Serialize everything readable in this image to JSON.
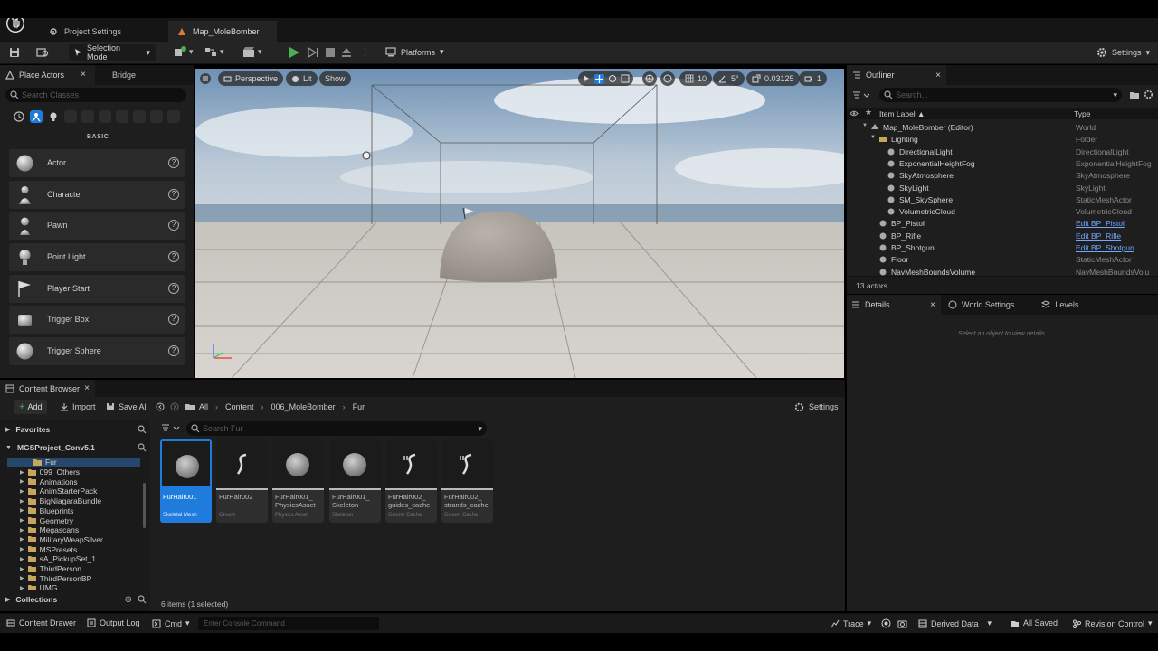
{
  "tabs": {
    "project_settings": "Project Settings",
    "map": "Map_MoleBomber"
  },
  "toolbar": {
    "selection_mode": "Selection Mode",
    "platforms": "Platforms",
    "settings": "Settings"
  },
  "place_actors": {
    "tab_label": "Place Actors",
    "bridge_label": "Bridge",
    "search_placeholder": "Search Classes",
    "category": "BASIC",
    "items": [
      {
        "label": "Actor",
        "icon": "sphere-icon"
      },
      {
        "label": "Character",
        "icon": "character-icon"
      },
      {
        "label": "Pawn",
        "icon": "pawn-icon"
      },
      {
        "label": "Point Light",
        "icon": "light-bulb-icon"
      },
      {
        "label": "Player Start",
        "icon": "player-start-icon"
      },
      {
        "label": "Trigger Box",
        "icon": "trigger-box-icon"
      },
      {
        "label": "Trigger Sphere",
        "icon": "trigger-sphere-icon"
      }
    ]
  },
  "viewport": {
    "perspective": "Perspective",
    "lit": "Lit",
    "show": "Show",
    "grid_size": "10",
    "rotation_snap": "5°",
    "scale_snap": "0.03125",
    "camera_speed": "1"
  },
  "outliner": {
    "title": "Outliner",
    "search_placeholder": "Search...",
    "col_label": "Item Label ▲",
    "col_type": "Type",
    "rows": [
      {
        "label": "Map_MoleBomber (Editor)",
        "type": "World",
        "link": false,
        "indent": 2
      },
      {
        "label": "Lighting",
        "type": "Folder",
        "link": false,
        "indent": 3
      },
      {
        "label": "DirectionalLight",
        "type": "DirectionalLight",
        "link": false,
        "indent": 4
      },
      {
        "label": "ExponentialHeightFog",
        "type": "ExponentialHeightFog",
        "link": false,
        "indent": 4
      },
      {
        "label": "SkyAtmosphere",
        "type": "SkyAtmosphere",
        "link": false,
        "indent": 4
      },
      {
        "label": "SkyLight",
        "type": "SkyLight",
        "link": false,
        "indent": 4
      },
      {
        "label": "SM_SkySphere",
        "type": "StaticMeshActor",
        "link": false,
        "indent": 4
      },
      {
        "label": "VolumetricCloud",
        "type": "VolumetricCloud",
        "link": false,
        "indent": 4
      },
      {
        "label": "BP_Pistol",
        "type": "Edit BP_Pistol",
        "link": true,
        "indent": 3
      },
      {
        "label": "BP_Rifle",
        "type": "Edit BP_Rifle",
        "link": true,
        "indent": 3
      },
      {
        "label": "BP_Shotgun",
        "type": "Edit BP_Shotgun",
        "link": true,
        "indent": 3
      },
      {
        "label": "Floor",
        "type": "StaticMeshActor",
        "link": false,
        "indent": 3
      },
      {
        "label": "NavMeshBoundsVolume",
        "type": "NavMeshBoundsVolu",
        "link": false,
        "indent": 3
      }
    ],
    "count": "13 actors"
  },
  "details": {
    "tab_details": "Details",
    "tab_world_settings": "World Settings",
    "tab_levels": "Levels",
    "empty_message": "Select an object to view details."
  },
  "content_browser": {
    "title": "Content Browser",
    "add": "Add",
    "import": "Import",
    "save_all": "Save All",
    "path": [
      "All",
      "Content",
      "006_MoleBomber",
      "Fur"
    ],
    "settings": "Settings",
    "favorites": "Favorites",
    "project": "MGSProject_Conv5.1",
    "search_placeholder": "Search Fur",
    "folders": [
      "Fur",
      "099_Others",
      "Animations",
      "AnimStarterPack",
      "BigNiagaraBundle",
      "Blueprints",
      "Geometry",
      "Megascans",
      "MilitaryWeapSilver",
      "MSPresets",
      "sA_PickupSet_1",
      "ThirdPerson",
      "ThirdPersonBP",
      "UMG"
    ],
    "collections": "Collections",
    "status": "6 items (1 selected)",
    "assets": [
      {
        "name": "FurHair001",
        "type": "Skeletal Mesh",
        "selected": true,
        "thumb": "sphere"
      },
      {
        "name": "FurHair002",
        "type": "Groom",
        "selected": false,
        "thumb": "strand"
      },
      {
        "name": "FurHair001_ PhysicsAsset",
        "type": "Physics Asset",
        "selected": false,
        "thumb": "sphere"
      },
      {
        "name": "FurHair001_ Skeleton",
        "type": "Skeleton",
        "selected": false,
        "thumb": "sphere"
      },
      {
        "name": "FurHair002_ guides_cache",
        "type": "Groom Cache",
        "selected": false,
        "thumb": "strand2"
      },
      {
        "name": "FurHair002_ strands_cache",
        "type": "Groom Cache",
        "selected": false,
        "thumb": "strand2"
      }
    ]
  },
  "statusbar": {
    "content_drawer": "Content Drawer",
    "output_log": "Output Log",
    "cmd": "Cmd",
    "console_placeholder": "Enter Console Command",
    "trace": "Trace",
    "derived_data": "Derived Data",
    "all_saved": "All Saved",
    "revision_control": "Revision Control"
  },
  "colors": {
    "accent_blue": "#1f7bdc",
    "play_green": "#4caf50",
    "link_blue": "#6fa8ff"
  }
}
